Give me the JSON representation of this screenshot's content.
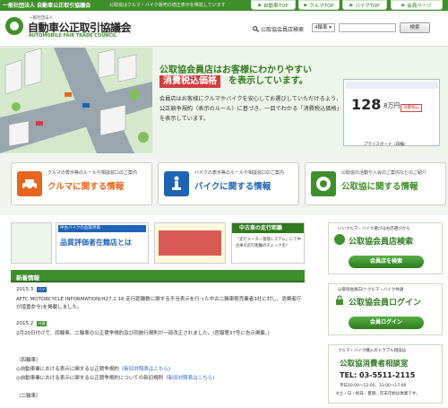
{
  "topbar": {
    "org": "一般社団法人 自動車公正取引協議会",
    "desc": "公取協はクルマ・バイク販売の適正表示を推進しています",
    "nav": [
      "自動車TOP",
      "クルマTOP",
      "バイクTOP",
      "会員ページ"
    ]
  },
  "header": {
    "logo_sub": "一般社団法人",
    "logo_name": "自動車公正取引協議会",
    "logo_en": "AUTOMOBILE FAIR TRADE COUNCIL",
    "search_label": "公取協会員店検索",
    "select_value": "4輪車",
    "search_button": "検索"
  },
  "hero": {
    "title": "公取協会員店はお客様にわかりやすい",
    "badge": "消費税込価格",
    "suffix": "を表示しています。",
    "body": "会員店はお客様にクルマやバイクを安心してお選びしていただけるよう、公正競争規約（表示のルール）に基づき、一目でわかる「消費税込価格」を表示しています。",
    "price": "128",
    "price_unit": "8万円",
    "price_tag": "消費税込",
    "caption": "プライスボード（四輪）"
  },
  "categories": [
    {
      "sub": "クルマの表示等のルールや相談窓口のご案内",
      "main": "クルマに関する情報",
      "color": "#e5671f"
    },
    {
      "sub": "バイクの表示等のルールや相談窓口のご案内",
      "main": "バイクに関する情報",
      "color": "#1f63b5"
    },
    {
      "sub": "公取協の活動や入会のご案内などのご紹介",
      "main": "公取協に関する情報",
      "color": "#3f8f2c"
    }
  ],
  "banners": {
    "b1_title": "中古バイクの品質評価",
    "b1_main": "品質評価者在籍店とは",
    "b2_title": "中古車の走行距離",
    "b2_text": "「走行メーター管理システム」にて中古車の走行距離のチェックを！"
  },
  "news": {
    "header": "新着情報",
    "items": [
      {
        "date": "2015.3",
        "tag": "バイク",
        "text": "AFTC MOTORCYCLE INFORMATION(H27.2.16 走行距離数に関する不当表示を行った中古二輪車販売業者3社に対し、消費者庁が措置命令)を掲載しました。"
      },
      {
        "date": "2015.2",
        "tag": "共通",
        "text": "2月20日付けで、四輪車、二輪車の公正競争規約及び同施行規則が一部改正されました。(官報第37号に告示掲載。)"
      }
    ],
    "sub1": "（四輪車）",
    "l1": "◎自動車業における表示に関する公正競争規約（",
    "l1_link": "新旧対照表はこちら",
    "l2": "◎自動車業における表示に関する公正競争規約についての新旧規則（",
    "l2_link": "新旧対照表はこちら",
    "sub2": "（二輪車）"
  },
  "right": {
    "box1_sub": "いいクルマ・バイク選びはお店選びから",
    "box1_title": "公取協会員店検索",
    "box1_button": "会員店を検索",
    "box2_sub": "公取協会員向け:クルマ・バイク共通",
    "box2_title": "公取協会員ログイン",
    "box2_button": "会員ログイン",
    "box3_sub": "クルマ・バイク購入のトラブル相談は",
    "box3_title": "公取協消費者相談室",
    "tel": "TEL: 03-5511-2115",
    "hours": "平日10:00〜12:00、13:00〜17:00",
    "days": "※土・日・祝日、夏期、年末年始は休業です。"
  }
}
